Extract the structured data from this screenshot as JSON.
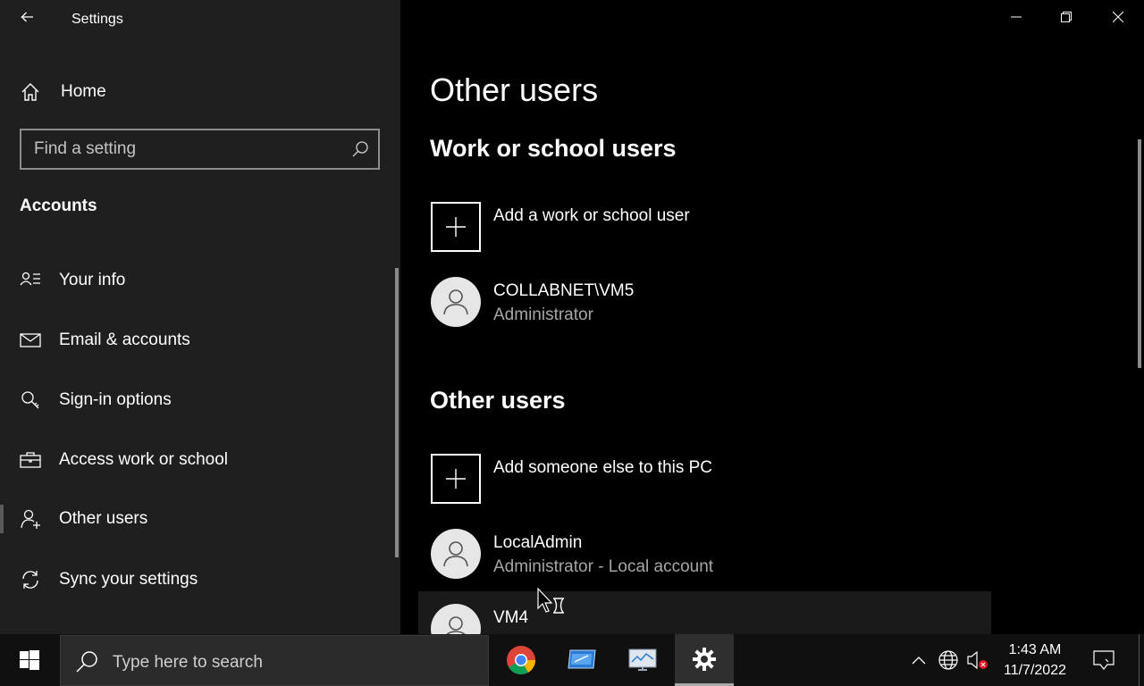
{
  "window": {
    "title": "Settings"
  },
  "sidebar": {
    "home_label": "Home",
    "search_placeholder": "Find a setting",
    "section_title": "Accounts",
    "items": [
      {
        "label": "Your info",
        "icon": "person-lines-icon"
      },
      {
        "label": "Email & accounts",
        "icon": "mail-icon"
      },
      {
        "label": "Sign-in options",
        "icon": "key-icon"
      },
      {
        "label": "Access work or school",
        "icon": "briefcase-icon"
      },
      {
        "label": "Other users",
        "icon": "add-person-icon",
        "active": true
      },
      {
        "label": "Sync your settings",
        "icon": "sync-icon"
      }
    ]
  },
  "main": {
    "page_title": "Other users",
    "work_section": {
      "heading": "Work or school users",
      "add_label": "Add a work or school user",
      "users": [
        {
          "name": "COLLABNET\\VM5",
          "role": "Administrator"
        }
      ]
    },
    "other_section": {
      "heading": "Other users",
      "add_label": "Add someone else to this PC",
      "users": [
        {
          "name": "LocalAdmin",
          "role": "Administrator - Local account"
        },
        {
          "name": "VM4"
        }
      ]
    }
  },
  "taskbar": {
    "search_placeholder": "Type here to search",
    "apps": [
      "chrome-icon",
      "remote-desktop-icon",
      "monitor-app-icon",
      "settings-gear-icon"
    ],
    "time": "1:43 AM",
    "date": "11/7/2022"
  }
}
